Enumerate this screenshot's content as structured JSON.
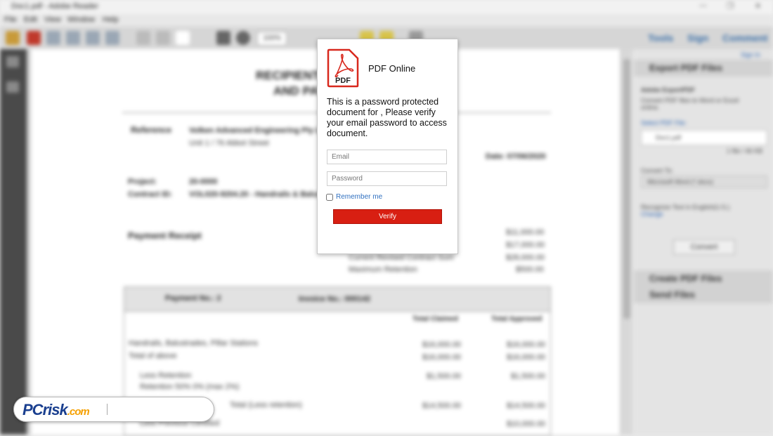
{
  "app": {
    "window_title": "Doc1.pdf - Adobe Reader",
    "menu": [
      "File",
      "Edit",
      "View",
      "Window",
      "Help"
    ],
    "zoom": "100%",
    "right_tabs": [
      "Tools",
      "Sign",
      "Comment"
    ]
  },
  "document": {
    "title_line1": "RECIPIENT C",
    "title_line2": "AND PAY",
    "reference_label": "Reference",
    "reference_value": "Volken Advanced Engineering Pty Ltd",
    "reference_sub": "Unit 1 / 76 Abbot Street",
    "invoice_label": "Date: 07/06/2020",
    "project_label": "Project:",
    "project_value": "20-0000",
    "contract_label": "Contract ID:",
    "contract_value": "VOL020-9204.20 - Handrails & Balustrades",
    "section_title": "Payment Receipt",
    "summary_rows": [
      {
        "label": "",
        "value": "$11,000.00"
      },
      {
        "label": "",
        "value": "$17,000.00"
      },
      {
        "label": "Current Revised Contract Sum",
        "value": "$28,000.00"
      },
      {
        "label": "Maximum Retention",
        "value": "$500.00"
      }
    ],
    "table_header_left": "Payment No.: 2",
    "table_header_mid": "Invoice No.: 000142",
    "col_claimed": "Total Claimed",
    "col_approved": "Total Approved",
    "rows": [
      {
        "label": "Handrails, Balustrades, Pillar Stations",
        "claimed": "$16,000.00",
        "approved": "$16,000.00"
      },
      {
        "label": "Total of above",
        "claimed": "$16,000.00",
        "approved": "$16,000.00"
      },
      {
        "label": "Less Retention",
        "claimed": "$1,500.00",
        "approved": "$1,500.00"
      },
      {
        "label": "Retention 50% 0% (max 2%)",
        "claimed": "",
        "approved": ""
      },
      {
        "label": "Total (Less retention)",
        "claimed": "$14,500.00",
        "approved": "$14,500.00"
      },
      {
        "label": "Less Previous Certified",
        "claimed": "",
        "approved": "$10,000.00"
      }
    ]
  },
  "panel": {
    "sign_in": "Sign In",
    "export_title": "Export PDF Files",
    "export_sub": "Adobe ExportPDF",
    "export_desc": "Convert PDF files to Word or Excel online.",
    "select_label": "Select PDF File:",
    "file_name": "Doc1.pdf",
    "file_count": "1 file / 46 KB",
    "convert_to": "Convert To:",
    "convert_option": "Microsoft Word (*.docx)",
    "recognize_text": "Recognize Text in English(U.S.)",
    "change_link": "Change",
    "convert_button": "Convert",
    "create_title": "Create PDF Files",
    "send_title": "Send Files"
  },
  "modal": {
    "title": "PDF Online",
    "icon_label": "PDF",
    "message": "This is a password protected document for , Please verify your email password to access document.",
    "email_placeholder": "Email",
    "password_placeholder": "Password",
    "remember_label": "Remember me",
    "verify_label": "Verify"
  },
  "watermark": {
    "brand_pc": "PC",
    "brand_risk": "risk",
    "brand_com": ".com"
  },
  "colors": {
    "verify_button": "#d81f12",
    "pdf_icon_red": "#d8281d",
    "link_blue": "#3070c0"
  }
}
